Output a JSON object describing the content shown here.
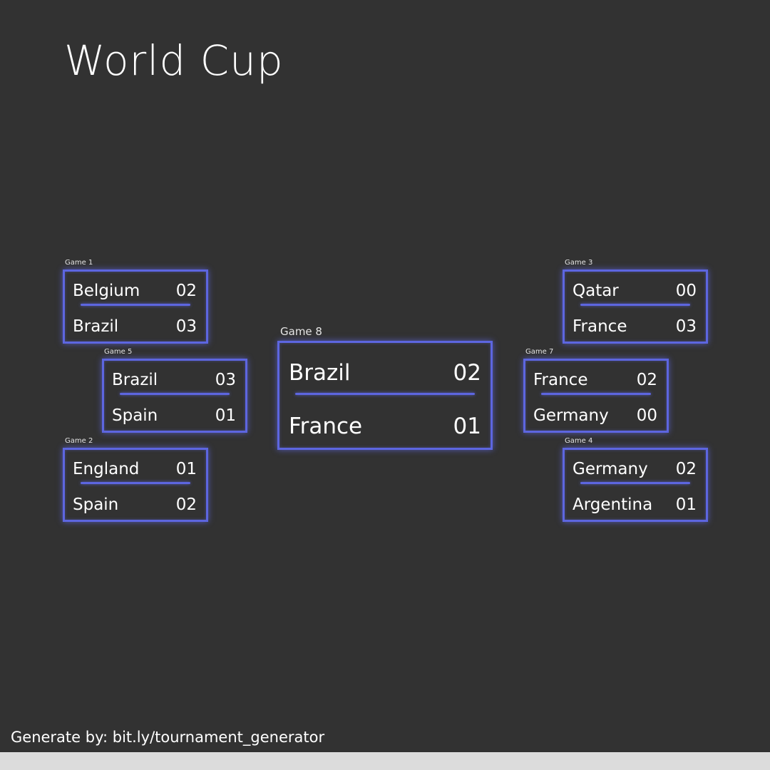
{
  "title": "World Cup",
  "games": {
    "game1": {
      "label": "Game 1",
      "team1": "Belgium",
      "score1": "02",
      "team2": "Brazil",
      "score2": "03"
    },
    "game2": {
      "label": "Game 2",
      "team1": "England",
      "score1": "01",
      "team2": "Spain",
      "score2": "02"
    },
    "game3": {
      "label": "Game 3",
      "team1": "Qatar",
      "score1": "00",
      "team2": "France",
      "score2": "03"
    },
    "game4": {
      "label": "Game 4",
      "team1": "Germany",
      "score1": "02",
      "team2": "Argentina",
      "score2": "01"
    },
    "game5": {
      "label": "Game 5",
      "team1": "Brazil",
      "score1": "03",
      "team2": "Spain",
      "score2": "01"
    },
    "game7": {
      "label": "Game 7",
      "team1": "France",
      "score1": "02",
      "team2": "Germany",
      "score2": "00"
    },
    "game8": {
      "label": "Game 8",
      "team1": "Brazil",
      "score1": "02",
      "team2": "France",
      "score2": "01"
    }
  },
  "footer": "Generate by: bit.ly/tournament_generator",
  "colors": {
    "background": "#323232",
    "accent": "#5d66e0",
    "text": "#ffffff",
    "bottom_bar": "#dcdcdc"
  }
}
